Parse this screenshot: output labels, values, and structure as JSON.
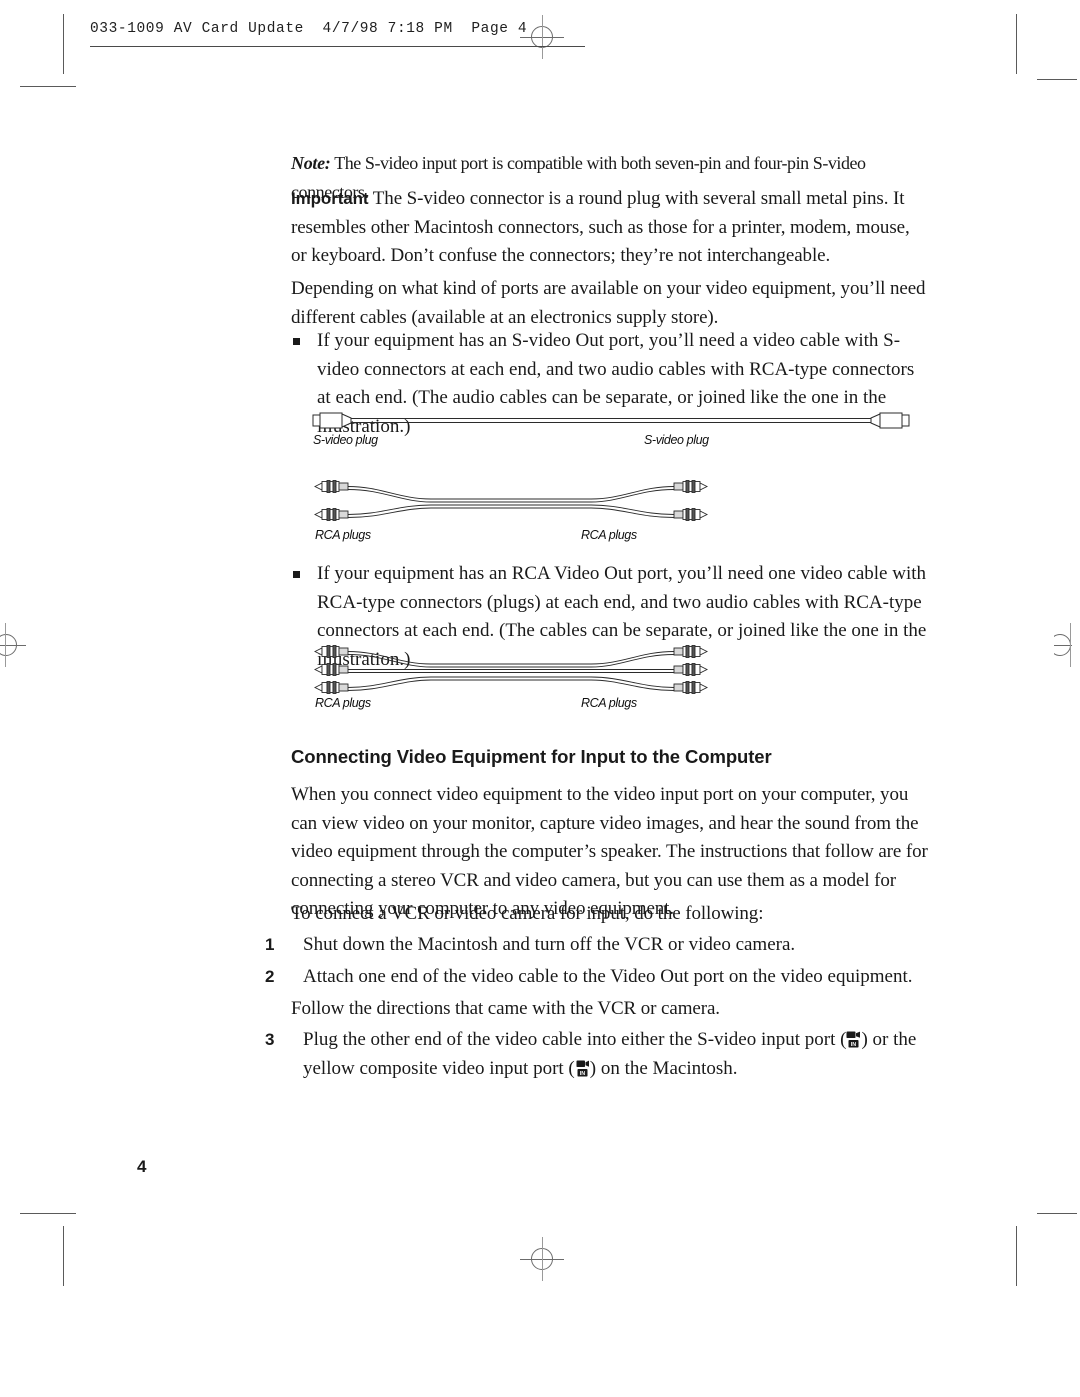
{
  "document": {
    "slug": "033-1009 AV Card Update  4/7/98 7:18 PM  Page 4",
    "page_number": "4"
  },
  "content": {
    "note_label": "Note:",
    "note_text": " The S-video input port is compatible with both seven-pin and four-pin S-video connectors.",
    "important_label": "Important",
    "important_text": "  The S-video connector is a round plug with several small metal pins. It resembles other Macintosh connectors, such as those for a printer, modem, mouse, or keyboard. Don’t confuse the connectors; they’re not interchangeable.",
    "intro_paragraph": "Depending on what kind of ports are available on your video equipment, you’ll need different cables (available at an electronics supply store).",
    "bullet_svideo": "If your equipment has an S-video Out port, you’ll need a video cable with S-video connectors at each end, and two audio cables with RCA-type connectors at each end. (The audio cables can be separate, or joined like the one in the illustration.)",
    "bullet_rca": "If your equipment has an RCA Video Out port, you’ll need one video cable with RCA-type connectors (plugs) at each end, and two audio cables with RCA-type connectors at each end. (The cables can be separate, or joined like the one in the illustration.)",
    "section_heading": "Connecting Video Equipment for Input to the Computer",
    "section_paragraph": "When you connect video equipment to the video input port on your computer, you can view video on your monitor, capture video images, and hear the sound from the video equipment through the computer’s speaker. The instructions that follow are for connecting a stereo VCR and video camera, but you can use them as a model for connecting your computer to any video equipment.",
    "steps_intro": "To connect a VCR or video camera for input, do the following:",
    "steps": [
      {
        "number": "1",
        "text": "Shut down the Macintosh and turn off the VCR or video camera."
      },
      {
        "number": "2",
        "text": "Attach one end of the video cable to the Video Out port on the video equipment."
      },
      {
        "number": "3",
        "text_a": "Plug the other end of the video cable into either the S-video input port (",
        "text_b": ") or the yellow composite video input port (",
        "text_c": ") on the Macintosh."
      }
    ],
    "step2_followup": "Follow the directions that came with the VCR or camera."
  },
  "figures": {
    "svideo_cable": {
      "caption_left": "S-video plug",
      "caption_right": "S-video plug"
    },
    "rca_pair_cable": {
      "caption_left": "RCA plugs",
      "caption_right": "RCA plugs"
    },
    "rca_triple_cable": {
      "caption_left": "RCA plugs",
      "caption_right": "RCA plugs"
    }
  },
  "colors": {
    "ink": "#1a1a1a",
    "rule": "#4a4a4a",
    "regmark": "#6b6b6b",
    "line_art": "#2b2b2b"
  }
}
